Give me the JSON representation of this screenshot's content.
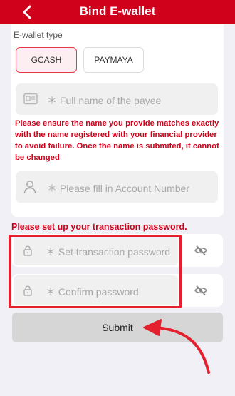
{
  "header": {
    "title": "Bind E-wallet",
    "back_icon": "chevron-left-icon"
  },
  "wallet_type": {
    "label": "E-wallet type",
    "options": [
      {
        "label": "GCASH",
        "selected": true
      },
      {
        "label": "PAYMAYA",
        "selected": false
      }
    ]
  },
  "form": {
    "name_placeholder": "＊ Full name of the payee",
    "warning": "Please ensure the name you provide matches exactly with the name registered with your financial provider to avoid failure. Once the name is submited, it cannot be changed",
    "account_placeholder": "＊ Please fill in Account Number"
  },
  "password": {
    "heading": "Please set up your transaction password.",
    "set_placeholder": "＊ Set transaction password",
    "confirm_placeholder": "＊ Confirm password"
  },
  "submit_label": "Submit",
  "colors": {
    "brand": "#d0021b",
    "annotation": "#e5202e"
  }
}
